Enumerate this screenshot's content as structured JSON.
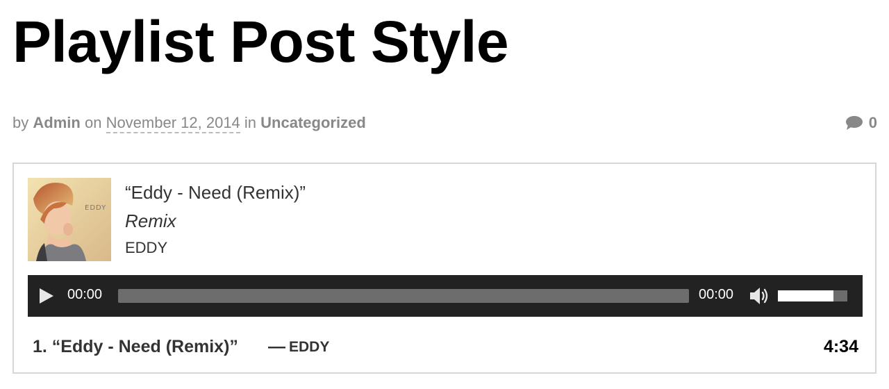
{
  "post": {
    "title": "Playlist Post Style",
    "meta": {
      "by_label": "by",
      "author": "Admin",
      "on_label": "on",
      "date": "November 12, 2014",
      "in_label": "in",
      "category": "Uncategorized",
      "comments_count": "0"
    }
  },
  "playlist": {
    "current": {
      "title": "“Eddy - Need (Remix)”",
      "album": "Remix",
      "artist": "EDDY",
      "cover_text": "EDDY"
    },
    "player": {
      "current_time": "00:00",
      "duration": "00:00",
      "progress_fraction": 0,
      "volume_fraction": 0.8
    },
    "tracks": [
      {
        "label": "1. “Eddy - Need (Remix)”",
        "separator": "—",
        "artist": "EDDY",
        "length": "4:34"
      }
    ]
  },
  "colors": {
    "player_bg": "#222222",
    "rail": "#6d6d6d",
    "meta_text": "#888888",
    "border": "#d6d6d6"
  },
  "icons": {
    "comment": "comment-bubble-icon",
    "play": "play-icon",
    "volume": "volume-icon"
  }
}
